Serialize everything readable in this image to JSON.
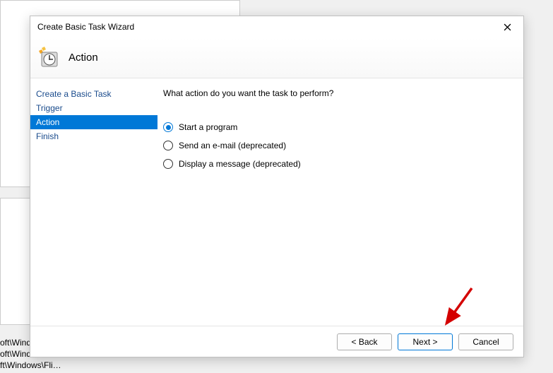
{
  "window": {
    "title": "Create Basic Task Wizard"
  },
  "banner": {
    "heading": "Action"
  },
  "sidebar": {
    "steps": [
      {
        "label": "Create a Basic Task",
        "selected": false
      },
      {
        "label": "Trigger",
        "selected": false
      },
      {
        "label": "Action",
        "selected": true
      },
      {
        "label": "Finish",
        "selected": false
      }
    ]
  },
  "content": {
    "prompt": "What action do you want the task to perform?",
    "options": [
      {
        "label": "Start a program",
        "checked": true
      },
      {
        "label": "Send an e-mail (deprecated)",
        "checked": false
      },
      {
        "label": "Display a message (deprecated)",
        "checked": false
      }
    ]
  },
  "footer": {
    "back": "< Back",
    "next": "Next >",
    "cancel": "Cancel"
  },
  "background": {
    "line1": "oft\\Wind…",
    "line2": "oft\\Windows\\U…",
    "line3": "ft\\Windows\\Fli…"
  }
}
